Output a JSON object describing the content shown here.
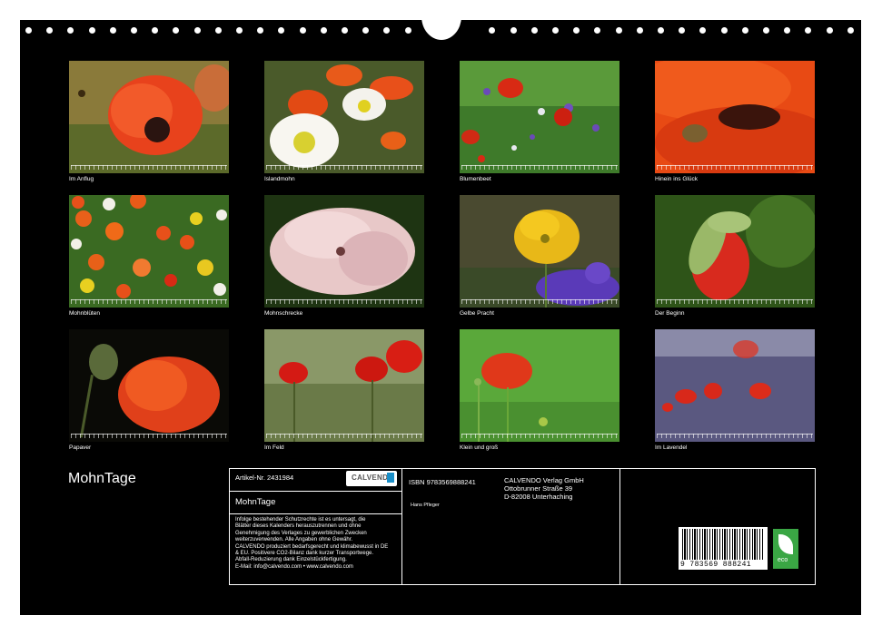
{
  "title": "MohnTage",
  "photos": [
    {
      "caption": "Im Anflug"
    },
    {
      "caption": "Islandmohn"
    },
    {
      "caption": "Blumenbeet"
    },
    {
      "caption": "Hinein ins Glück"
    },
    {
      "caption": "Mohnblüten"
    },
    {
      "caption": "Mohnschrecke"
    },
    {
      "caption": "Gelbe Pracht"
    },
    {
      "caption": "Der Beginn"
    },
    {
      "caption": "Papaver"
    },
    {
      "caption": "Im Feld"
    },
    {
      "caption": "Klein und groß"
    },
    {
      "caption": "Im Lavendel"
    }
  ],
  "info": {
    "article_no": "Artikel-Nr. 2431984",
    "logo_text": "CALVENDO",
    "product_title": "MohnTage",
    "notice": [
      "Infolge bestehender Schutzrechte ist es untersagt, die",
      "Blätter dieses Kalenders herauszutrennen und ohne",
      "Genehmigung des Verlages zu gewerblichen Zwecken",
      "weiterzuverwenden. Alle Angaben ohne Gewähr.",
      "CALVENDO produziert bedarfsgerecht und klimabewusst in DE",
      "& EU. Positivere CO2-Bilanz dank kurzer Transportwege.",
      "Abfall-Reduzierung dank Einzelstückfertigung.",
      "E-Mail: info@calvendo.com • www.calvendo.com"
    ],
    "isbn": "ISBN 9783569888241",
    "publisher": [
      "CALVENDO Verlag GmbH",
      "Ottobrunner Straße 39",
      "D-82008 Unterhaching"
    ],
    "author": "Hans Pfleger",
    "barcode_number": "9 783569 888241",
    "eco_label": "eco"
  }
}
